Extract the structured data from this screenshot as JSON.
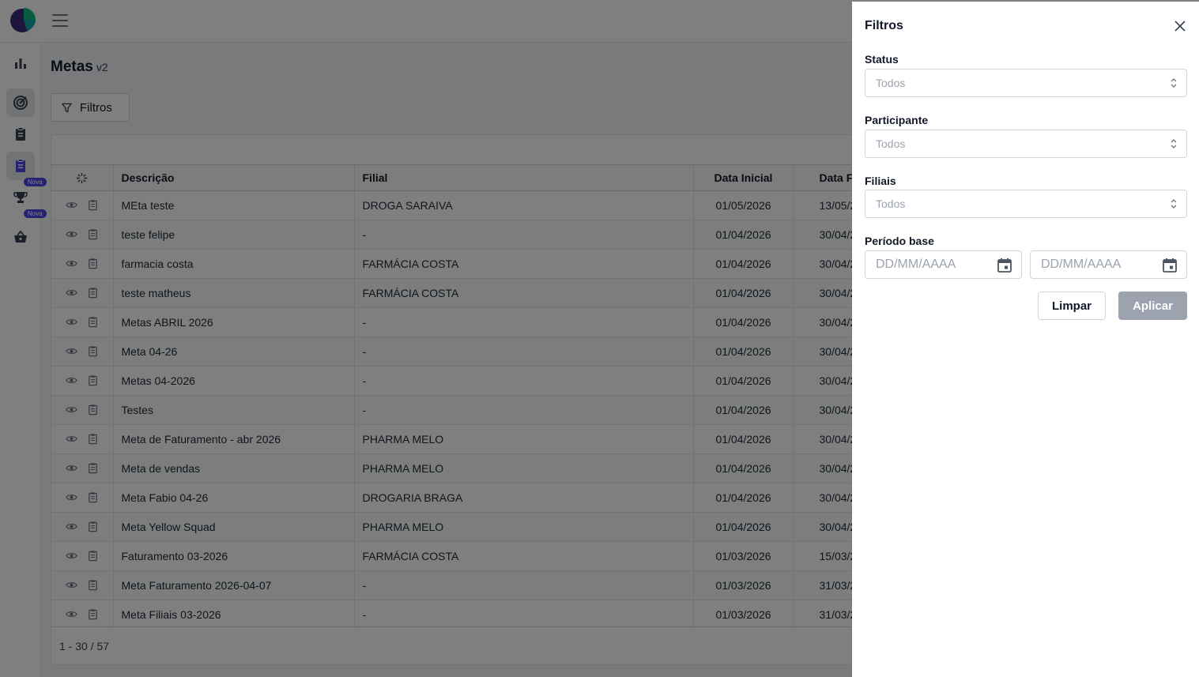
{
  "page": {
    "title": "Metas",
    "version": "v2",
    "filter_button": "Filtros"
  },
  "sidebar": {
    "badges": [
      "Nova",
      "Nova"
    ]
  },
  "table": {
    "headers": [
      "Descrição",
      "Filial",
      "Data Inicial",
      "Data F"
    ],
    "rows": [
      {
        "descricao": "MEta teste",
        "filial": "DROGA SARAIVA",
        "inicio": "01/05/2026",
        "fim": "13/05/2"
      },
      {
        "descricao": "teste felipe",
        "filial": "-",
        "inicio": "01/04/2026",
        "fim": "30/04/2"
      },
      {
        "descricao": "farmacia costa",
        "filial": "FARMÁCIA COSTA",
        "inicio": "01/04/2026",
        "fim": "30/04/2"
      },
      {
        "descricao": "teste matheus",
        "filial": "FARMÁCIA COSTA",
        "inicio": "01/04/2026",
        "fim": "30/04/2"
      },
      {
        "descricao": "Metas ABRIL 2026",
        "filial": "-",
        "inicio": "01/04/2026",
        "fim": "30/04/2"
      },
      {
        "descricao": "Meta 04-26",
        "filial": "-",
        "inicio": "01/04/2026",
        "fim": "30/04/2"
      },
      {
        "descricao": "Metas 04-2026",
        "filial": "-",
        "inicio": "01/04/2026",
        "fim": "30/04/2"
      },
      {
        "descricao": "Testes",
        "filial": "-",
        "inicio": "01/04/2026",
        "fim": "30/04/2"
      },
      {
        "descricao": "Meta de Faturamento - abr 2026",
        "filial": "PHARMA MELO",
        "inicio": "01/04/2026",
        "fim": "30/04/2"
      },
      {
        "descricao": "Meta de vendas",
        "filial": "PHARMA MELO",
        "inicio": "01/04/2026",
        "fim": "30/04/2"
      },
      {
        "descricao": "Meta Fabio 04-26",
        "filial": "DROGARIA BRAGA",
        "inicio": "01/04/2026",
        "fim": "30/04/2"
      },
      {
        "descricao": "Meta Yellow Squad",
        "filial": "PHARMA MELO",
        "inicio": "01/04/2026",
        "fim": "30/04/2"
      },
      {
        "descricao": "Faturamento 03-2026",
        "filial": "FARMÁCIA COSTA",
        "inicio": "01/03/2026",
        "fim": "15/03/2"
      },
      {
        "descricao": "Meta Faturamento 2026-04-07",
        "filial": "-",
        "inicio": "01/03/2026",
        "fim": "31/03/2"
      },
      {
        "descricao": "Meta Filiais 03-2026",
        "filial": "-",
        "inicio": "01/03/2026",
        "fim": "31/03/2"
      }
    ],
    "pagination": "1 - 30 / 57"
  },
  "drawer": {
    "title": "Filtros",
    "status_label": "Status",
    "status_value": "Todos",
    "participante_label": "Participante",
    "participante_value": "Todos",
    "filiais_label": "Filiais",
    "filiais_value": "Todos",
    "periodo_label": "Período base",
    "date_start_placeholder": "DD/MM/AAAA",
    "date_end_placeholder": "DD/MM/AAAA",
    "clear_label": "Limpar",
    "apply_label": "Aplicar"
  },
  "colors": {
    "accent": "#4f46e5",
    "overlay": "#000000",
    "apply_disabled": "#9ca3af"
  }
}
